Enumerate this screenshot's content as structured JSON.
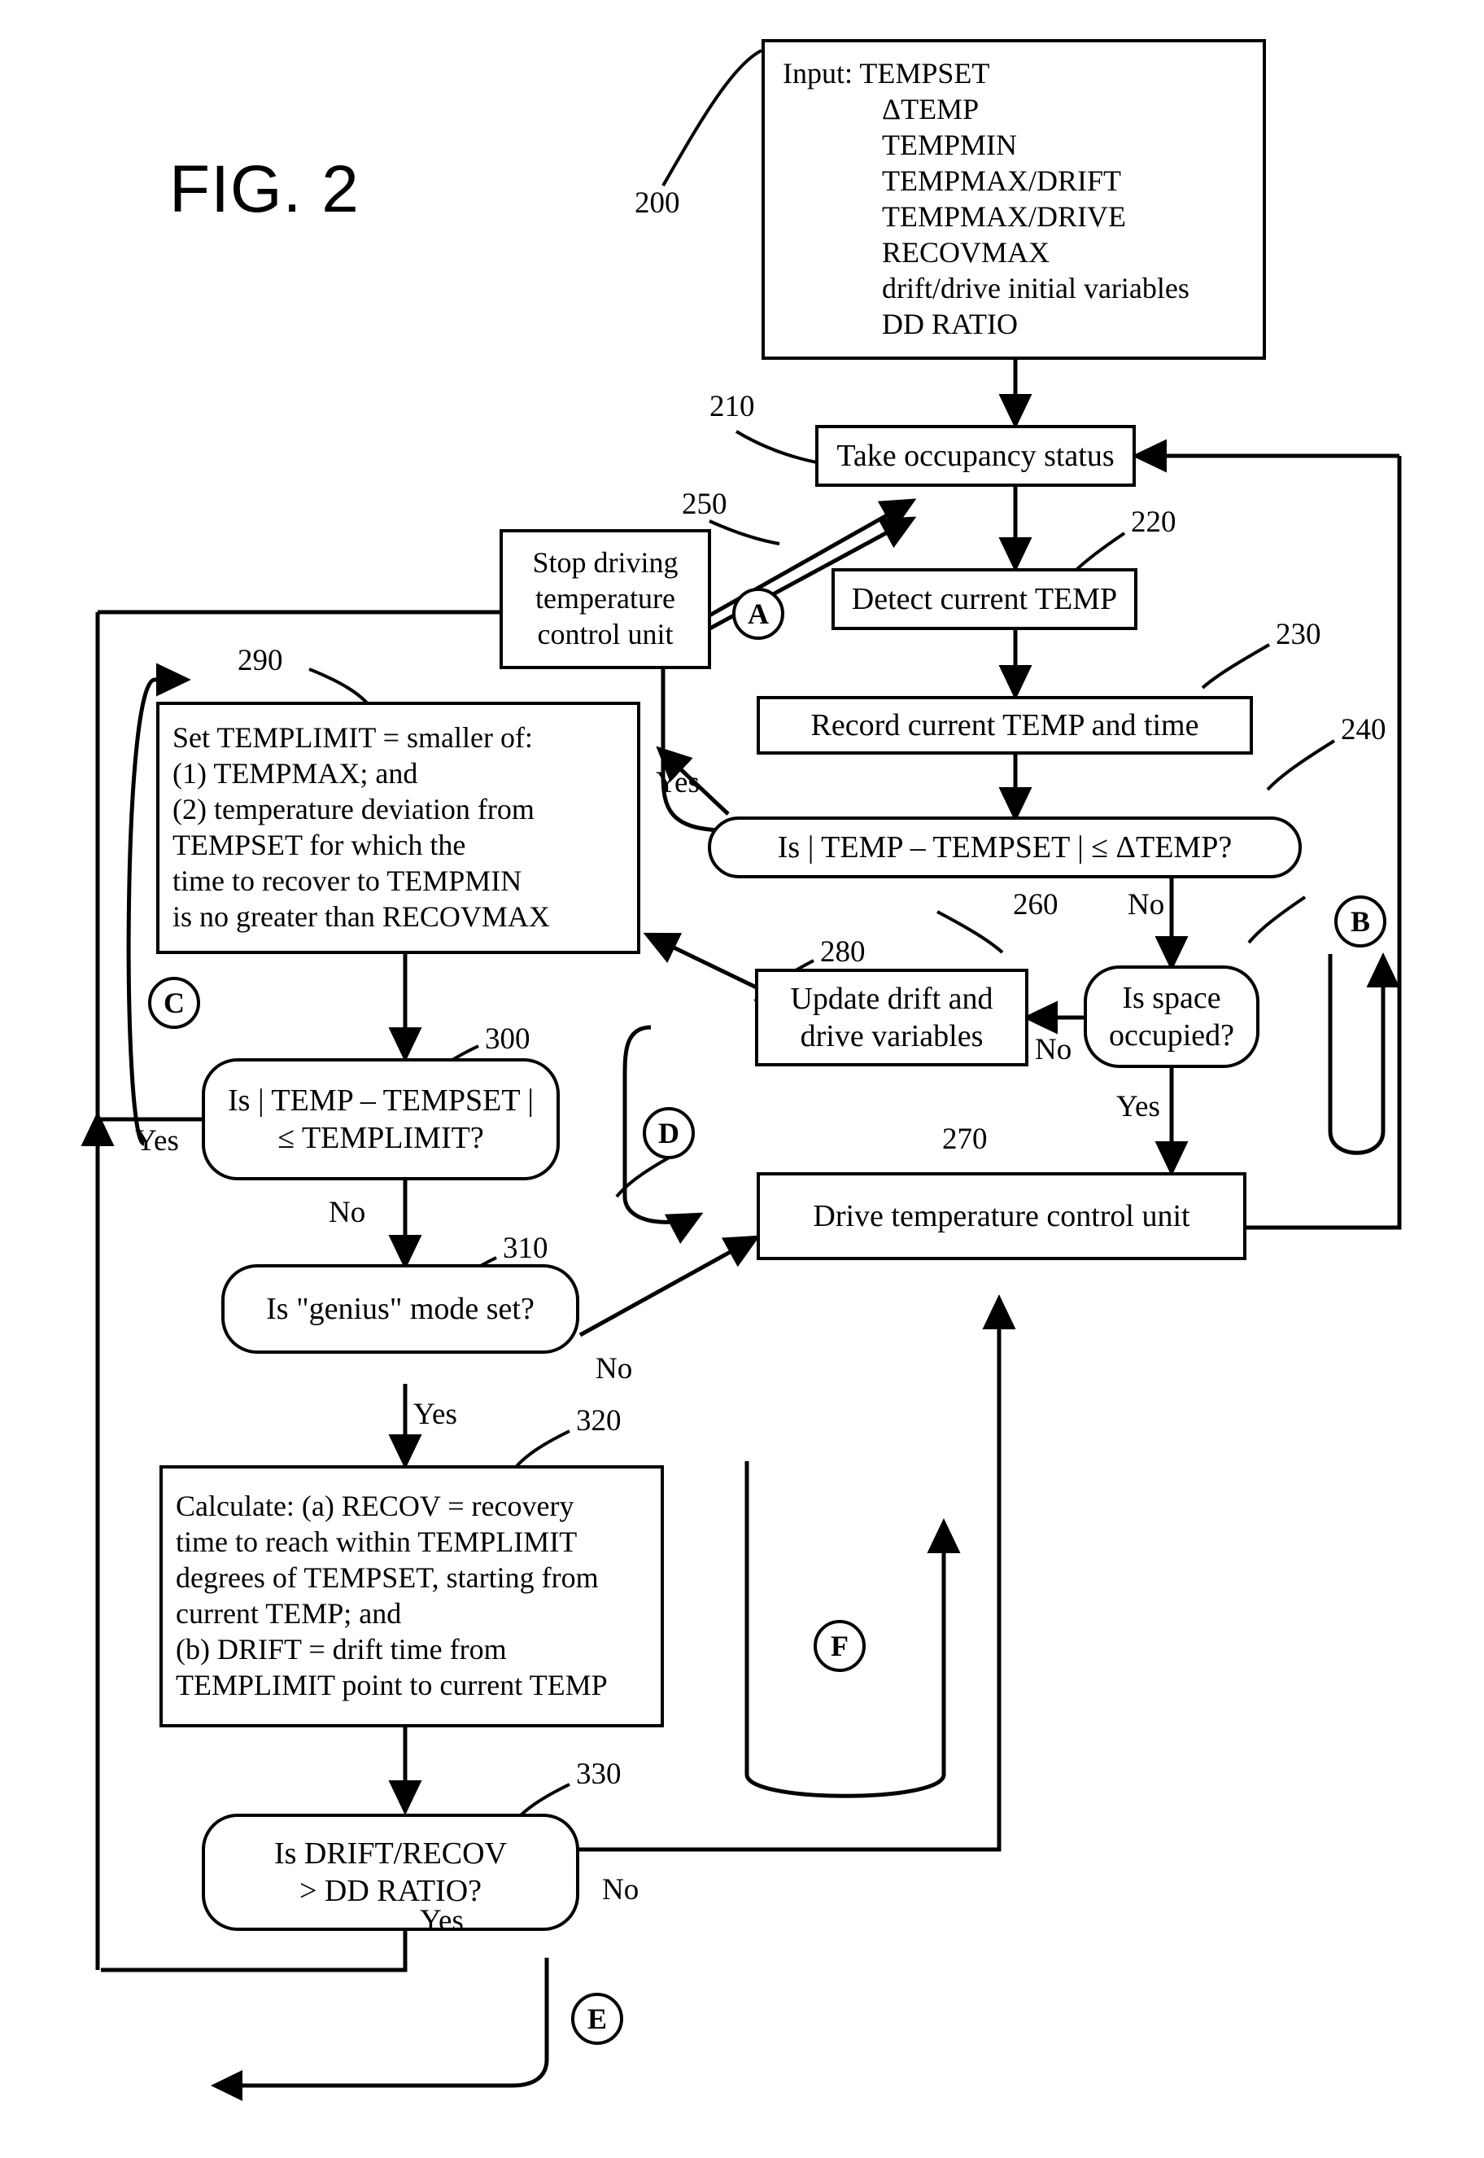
{
  "figure": {
    "label": "FIG. 2"
  },
  "nodes": {
    "input_200": {
      "ref": "200",
      "lines": [
        "Input:  TEMPSET",
        "ΔTEMP",
        "TEMPMIN",
        "TEMPMAX/DRIFT",
        "TEMPMAX/DRIVE",
        "RECOVMAX",
        "drift/drive initial variables",
        "DD RATIO"
      ]
    },
    "take_occupancy_210": {
      "ref": "210",
      "text": "Take occupancy status"
    },
    "detect_temp_220": {
      "ref": "220",
      "text": "Detect current TEMP"
    },
    "record_temp_230": {
      "ref": "230",
      "text": "Record current TEMP and time"
    },
    "is_temp_within_240": {
      "ref": "240",
      "text": "Is  | TEMP – TEMPSET | ≤ ΔTEMP?"
    },
    "stop_driving_250": {
      "ref": "250",
      "text": "Stop driving temperature control unit"
    },
    "is_space_occupied_260": {
      "ref": "260",
      "text": "Is space occupied?"
    },
    "drive_unit_270": {
      "ref": "270",
      "text": "Drive temperature control unit"
    },
    "update_drift_280": {
      "ref": "280",
      "text": "Update drift and drive variables"
    },
    "set_templimit_290": {
      "ref": "290",
      "lines": [
        "Set TEMPLIMIT = smaller of:",
        "(1) TEMPMAX; and",
        "(2) temperature deviation from",
        "TEMPSET for which the",
        "time to recover to TEMPMIN",
        "is no greater than RECOVMAX"
      ]
    },
    "is_temp_templimit_300": {
      "ref": "300",
      "line1": "Is  | TEMP – TEMPSET |",
      "line2": "≤ TEMPLIMIT?"
    },
    "is_genius_310": {
      "ref": "310",
      "text": "Is \"genius\" mode set?"
    },
    "calculate_320": {
      "ref": "320",
      "lines": [
        "Calculate: (a) RECOV = recovery",
        "time to reach within TEMPLIMIT",
        "degrees of TEMPSET, starting from",
        "current TEMP; and",
        "(b) DRIFT = drift time from",
        "TEMPLIMIT point to current TEMP"
      ]
    },
    "is_ddratio_330": {
      "ref": "330",
      "line1": "Is  DRIFT/RECOV",
      "line2": "> DD RATIO?"
    }
  },
  "connectors": {
    "a": "A",
    "b": "B",
    "c": "C",
    "d": "D",
    "e": "E",
    "f": "F"
  },
  "edge_labels": {
    "yes_240": "Yes",
    "no_240": "No",
    "no_260": "No",
    "yes_260": "Yes",
    "yes_300": "Yes",
    "no_300": "No",
    "no_310": "No",
    "yes_310": "Yes",
    "no_330": "No",
    "yes_330": "Yes"
  }
}
